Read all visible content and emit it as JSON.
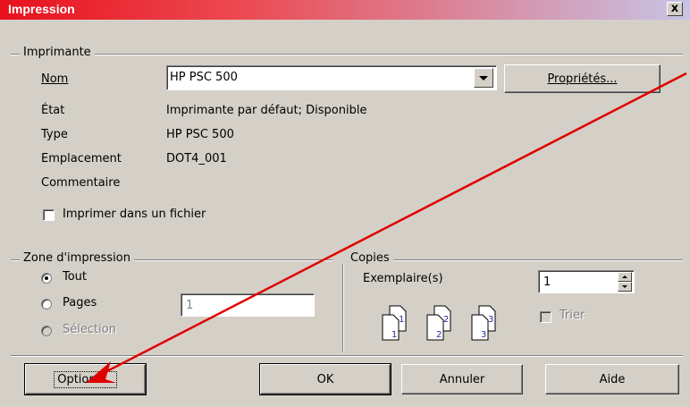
{
  "window": {
    "title": "Impression",
    "close_label": "x"
  },
  "printer_group": {
    "label": "Imprimante",
    "name_label": "Nom",
    "name_value": "HP PSC 500",
    "properties_button": "Propriétés...",
    "state_label": "État",
    "state_value": "Imprimante par défaut; Disponible",
    "type_label": "Type",
    "type_value": "HP PSC 500",
    "location_label": "Emplacement",
    "location_value": "DOT4_001",
    "comment_label": "Commentaire",
    "print_to_file_label": "Imprimer dans un fichier"
  },
  "print_range": {
    "label": "Zone d'impression",
    "all_label": "Tout",
    "pages_label": "Pages",
    "pages_value": "1",
    "selection_label": "Sélection",
    "selected": "Tout"
  },
  "copies": {
    "label": "Copies",
    "count_label": "Exemplaire(s)",
    "count_value": "1",
    "collate_label": "Trier",
    "collate_icon": "collate-pages-icon",
    "page_numbers": [
      "1",
      "1",
      "2",
      "2",
      "3",
      "3"
    ]
  },
  "buttons": {
    "options": "Options...",
    "ok": "OK",
    "cancel": "Annuler",
    "help": "Aide"
  },
  "annotation": {
    "arrow_color": "#e00000"
  },
  "colors": {
    "title_start": "#e8101c",
    "title_end": "#c7c4e6",
    "dialog_bg": "#d4d0c8"
  }
}
